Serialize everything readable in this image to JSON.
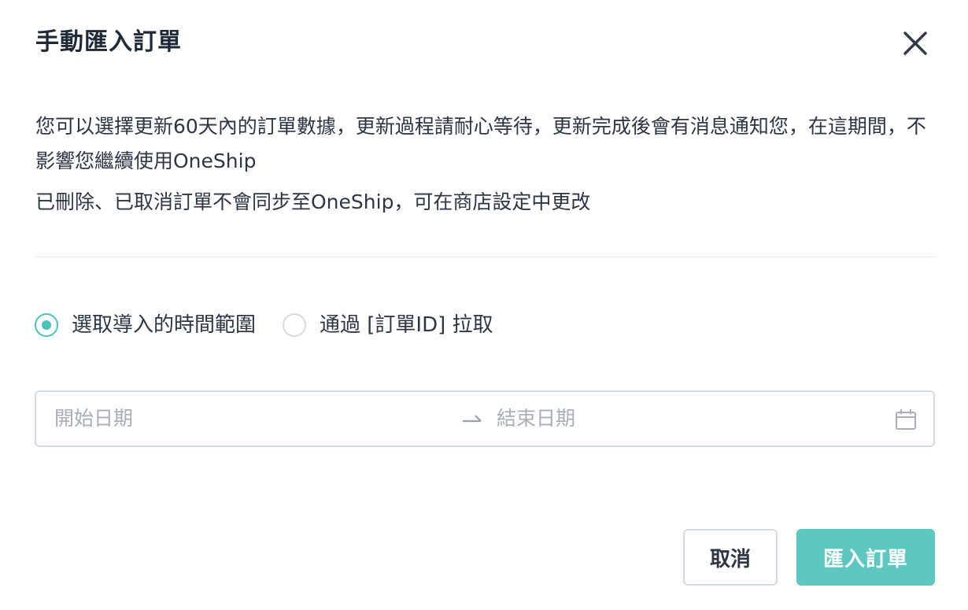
{
  "dialog": {
    "title": "手動匯入訂單",
    "close_icon": "close-icon"
  },
  "description": {
    "line1": "您可以選擇更新60天內的訂單數據，更新過程請耐心等待，更新完成後會有消息通知您，在這期間，不影響您繼續使用OneShip",
    "line2": "已刪除、已取消訂單不會同步至OneShip，可在商店設定中更改"
  },
  "import_mode": {
    "options": [
      {
        "label": "選取導入的時間範圍",
        "checked": true
      },
      {
        "label": "通過 [訂單ID] 拉取",
        "checked": false
      }
    ]
  },
  "date_range": {
    "start_placeholder": "開始日期",
    "end_placeholder": "結束日期",
    "separator_icon": "arrow-right-icon",
    "calendar_icon": "calendar-icon"
  },
  "footer": {
    "cancel_label": "取消",
    "import_label": "匯入訂單"
  },
  "colors": {
    "accent": "#4bc2b9",
    "primary_button": "#5ec8c0",
    "border": "#d4dbe3",
    "text": "#2c3644",
    "placeholder": "#a7aeb8"
  }
}
